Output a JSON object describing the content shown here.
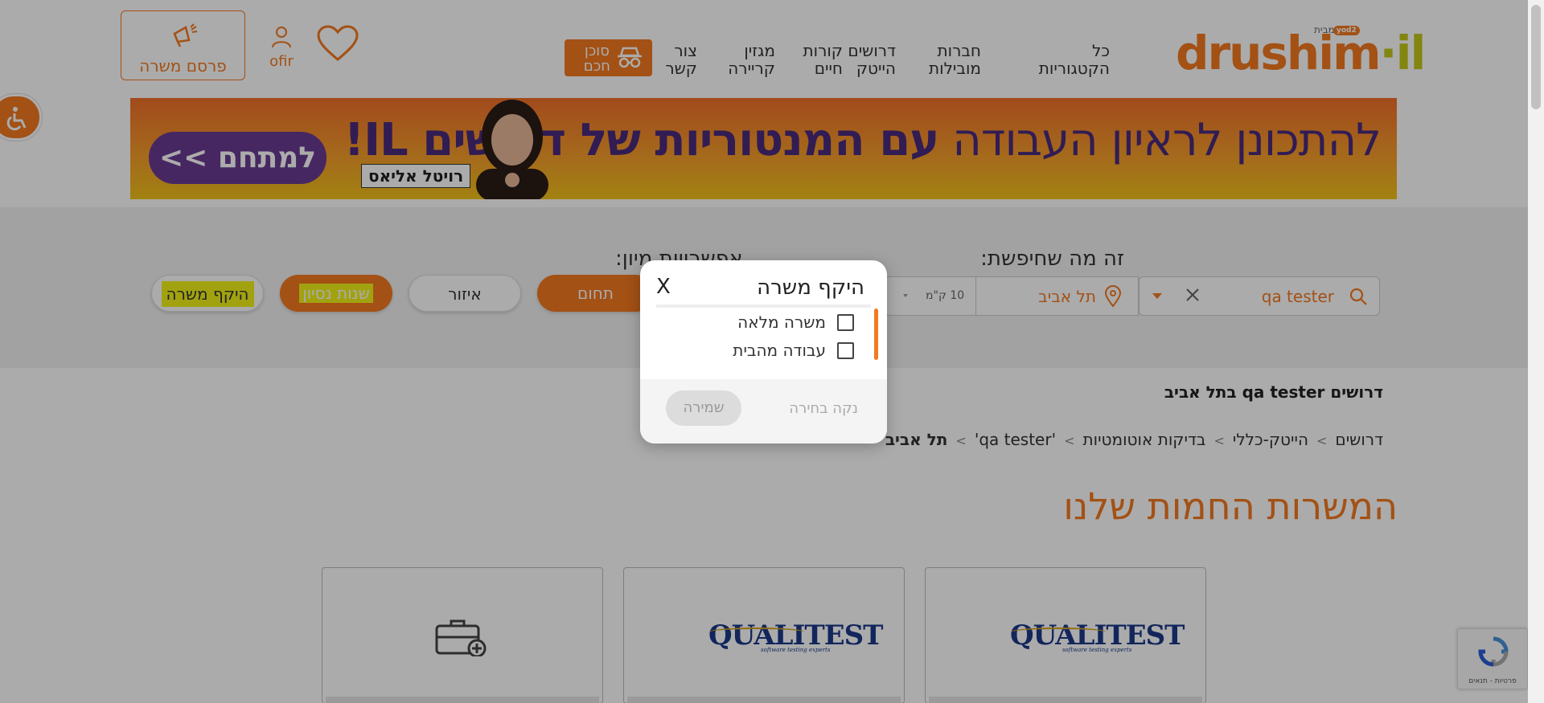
{
  "header": {
    "logo_text": "drushim",
    "logo_suffix": "·il",
    "logo_by": "מבית",
    "logo_badge": "yod2",
    "nav": [
      {
        "label": "כל\nהקטגוריות"
      },
      {
        "label": "חברות\nמובילות"
      },
      {
        "label": "דרושים\nהייטק"
      },
      {
        "label": "קורות\nחיים"
      },
      {
        "label": "מגזין\nקריירה"
      },
      {
        "label": "צור\nקשר"
      }
    ],
    "smart_agent_label": "סוכן\nחכם",
    "user_name": "ofir",
    "post_job_label": "פרסם משרה"
  },
  "banner": {
    "headline_light": "להתכונן לראיון העבודה ",
    "headline_bold": "עם המנטוריות של דרושים IL!",
    "cta": "למתחם >>",
    "person_name": "רויטל אליאס"
  },
  "search": {
    "title": "זה מה שחיפשת:",
    "filter_title": "אפשרויות מיון:",
    "query": "qa tester",
    "location": "תל אביב",
    "radius": "10 ק\"מ",
    "filters": {
      "field": "תחום",
      "area": "איזור",
      "experience": "שנות נסיון",
      "scope": "היקף משרה"
    }
  },
  "results": {
    "title": "דרושים qa tester בתל אביב",
    "breadcrumb": [
      "דרושים",
      "הייטק-כללי",
      "בדיקות אוטומטיות",
      "'qa tester'",
      "תל אביב"
    ],
    "hot_title": "המשרות החמות שלנו",
    "cards": [
      {
        "company": "QUALITEST",
        "tagline": "software testing experts"
      },
      {
        "company": "QUALITEST",
        "tagline": "software testing experts"
      },
      {
        "company": ""
      }
    ]
  },
  "recaptcha": {
    "terms": "פרטיות - תנאים"
  },
  "modal": {
    "title": "היקף משרה",
    "close": "X",
    "options": [
      {
        "label": "משרה מלאה",
        "checked": false
      },
      {
        "label": "עבודה מהבית",
        "checked": false
      }
    ],
    "save": "שמירה",
    "clear": "נקה בחירה"
  },
  "colors": {
    "brand": "#f47920",
    "accent_yellow": "#f2f21a",
    "brand_green": "#c4c61a"
  }
}
